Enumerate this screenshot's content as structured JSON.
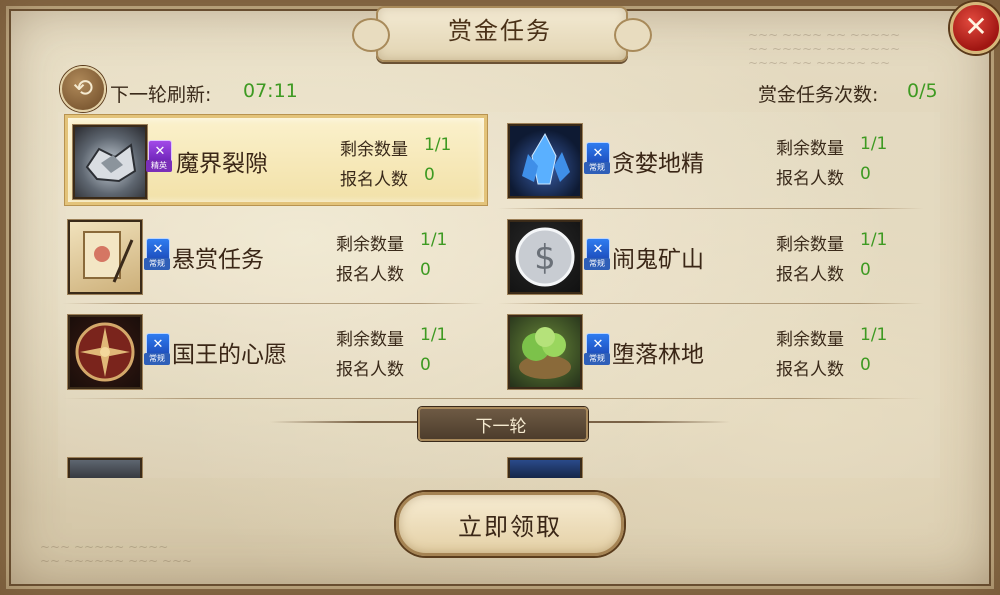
{
  "window": {
    "title": "赏金任务",
    "close_icon": "close-icon"
  },
  "header": {
    "refresh_label": "下一轮刷新:",
    "refresh_time": "07:11",
    "count_label": "赏金任务次数:",
    "count_value": "0/5"
  },
  "stat_labels": {
    "remaining": "剩余数量",
    "signups": "报名人数"
  },
  "tasks": [
    {
      "name": "魔界裂隙",
      "remaining": "1/1",
      "signups": "0",
      "badge_color": "purple",
      "badge_tag": "精英",
      "icon": "broken-machine-icon",
      "selected": true
    },
    {
      "name": "贪婪地精",
      "remaining": "1/1",
      "signups": "0",
      "badge_color": "blue",
      "badge_tag": "常规",
      "icon": "blue-crystal-icon",
      "selected": false
    },
    {
      "name": "悬赏任务",
      "remaining": "1/1",
      "signups": "0",
      "badge_color": "blue",
      "badge_tag": "常规",
      "icon": "scroll-quill-icon",
      "selected": false
    },
    {
      "name": "闹鬼矿山",
      "remaining": "1/1",
      "signups": "0",
      "badge_color": "blue",
      "badge_tag": "常规",
      "icon": "silver-coin-icon",
      "selected": false
    },
    {
      "name": "国王的心愿",
      "remaining": "1/1",
      "signups": "0",
      "badge_color": "blue",
      "badge_tag": "常规",
      "icon": "compass-emblem-icon",
      "selected": false
    },
    {
      "name": "堕落林地",
      "remaining": "1/1",
      "signups": "0",
      "badge_color": "blue",
      "badge_tag": "常规",
      "icon": "forest-island-icon",
      "selected": false
    }
  ],
  "divider": {
    "label": "下一轮"
  },
  "claim_button": {
    "label": "立即领取"
  },
  "colors": {
    "accent_green": "#3e9a22",
    "parchment": "#e6dcc3",
    "close_red": "#c0241c",
    "badge_blue": "#2f7cf0",
    "badge_purple": "#a24ae8"
  }
}
